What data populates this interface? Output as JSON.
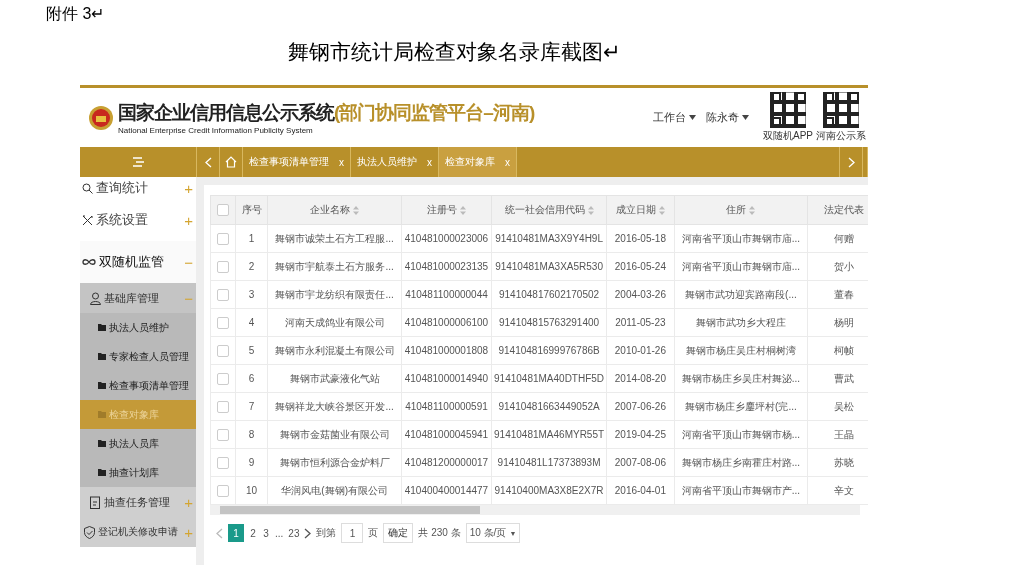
{
  "document": {
    "caption": "附件 3↵",
    "title": "舞钢市统计局检查对象名录库截图↵"
  },
  "header": {
    "logo_title": "国家企业信用信息公示系统",
    "logo_subtitle": "(部门协同监管平台–河南)",
    "logo_english": "National Enterprise Credit Information Publicity System",
    "menus": [
      "工作台",
      "陈永奇"
    ],
    "qr_codes": [
      {
        "label": "双随机APP"
      },
      {
        "label": "河南公示系"
      }
    ]
  },
  "tabs": [
    {
      "label": "检查事项清单管理",
      "selected": false,
      "close": "x"
    },
    {
      "label": "执法人员维护",
      "selected": false,
      "close": "x"
    },
    {
      "label": "检查对象库",
      "selected": true,
      "close": "x"
    }
  ],
  "sidebar": [
    {
      "label": "查询统计",
      "expanded": false,
      "toggle": "+"
    },
    {
      "label": "系统设置",
      "expanded": false,
      "toggle": "+"
    },
    {
      "label": "双随机监管",
      "expanded": true,
      "toggle": "−",
      "children": [
        {
          "label": "基础库管理",
          "expanded": true,
          "toggle": "−",
          "children": [
            {
              "label": "执法人员维护",
              "selected": false
            },
            {
              "label": "专家检查人员管理",
              "selected": false
            },
            {
              "label": "检查事项清单管理",
              "selected": false
            },
            {
              "label": "检查对象库",
              "selected": true
            },
            {
              "label": "执法人员库",
              "selected": false
            },
            {
              "label": "抽查计划库",
              "selected": false
            }
          ]
        },
        {
          "label": "抽查任务管理",
          "expanded": false,
          "toggle": "+"
        },
        {
          "label": "登记机关修改申请",
          "expanded": false,
          "toggle": "+"
        }
      ]
    }
  ],
  "table": {
    "select_all_checked": false,
    "columns": [
      {
        "label": "序号",
        "sortable": false
      },
      {
        "label": "企业名称",
        "sortable": true
      },
      {
        "label": "注册号",
        "sortable": true
      },
      {
        "label": "统一社会信用代码",
        "sortable": true
      },
      {
        "label": "成立日期",
        "sortable": true
      },
      {
        "label": "住所",
        "sortable": true
      },
      {
        "label": "法定代表",
        "sortable": false
      }
    ],
    "rows": [
      {
        "checked": false,
        "cells": [
          "1",
          "舞钢市诚荣土石方工程服...",
          "410481000023006",
          "91410481MA3X9Y4H9L",
          "2016-05-18",
          "河南省平顶山市舞钢市庙...",
          "何赠"
        ]
      },
      {
        "checked": false,
        "cells": [
          "2",
          "舞钢市宇航泰土石方服务...",
          "410481000023135",
          "91410481MA3XA5R530",
          "2016-05-24",
          "河南省平顶山市舞钢市庙...",
          "贺小"
        ]
      },
      {
        "checked": false,
        "cells": [
          "3",
          "舞钢市宇龙纺织有限责任...",
          "410481100000044",
          "914104817602170502",
          "2004-03-26",
          "舞钢市武功迎宾路南段(...",
          "董春"
        ]
      },
      {
        "checked": false,
        "cells": [
          "4",
          "河南天成鸽业有限公司",
          "410481000006100",
          "914104815763291400",
          "2011-05-23",
          "舞钢市武功乡大程庄",
          "杨明"
        ]
      },
      {
        "checked": false,
        "cells": [
          "5",
          "舞钢市永利混凝土有限公司",
          "410481000001808",
          "91410481699976786B",
          "2010-01-26",
          "舞钢市杨庄吴庄村桐树湾",
          "柯帧"
        ]
      },
      {
        "checked": false,
        "cells": [
          "6",
          "舞钢市武豪液化气站",
          "410481000014940",
          "91410481MA40DTHF5D",
          "2014-08-20",
          "舞钢市杨庄乡吴庄村舞泌...",
          "曹武"
        ]
      },
      {
        "checked": false,
        "cells": [
          "7",
          "舞钢祥龙大峡谷景区开发...",
          "410481100000591",
          "91410481663449052A",
          "2007-06-26",
          "舞钢市杨庄乡鏖坪村(完...",
          "吴松"
        ]
      },
      {
        "checked": false,
        "cells": [
          "8",
          "舞钢市金菇菌业有限公司",
          "410481000045941",
          "91410481MA46MYR55T",
          "2019-04-25",
          "河南省平顶山市舞钢市杨...",
          "王晶"
        ]
      },
      {
        "checked": false,
        "cells": [
          "9",
          "舞钢市恒利源合金炉料厂",
          "410481200000017",
          "91410481L17373893M",
          "2007-08-06",
          "舞钢市杨庄乡南霍庄村路...",
          "苏晓"
        ]
      },
      {
        "checked": false,
        "cells": [
          "10",
          "华润风电(舞钢)有限公司",
          "410400400014477",
          "91410400MA3X8E2X7R",
          "2016-04-01",
          "河南省平顶山市舞钢市产...",
          "辛文"
        ]
      }
    ]
  },
  "pagination": {
    "pages": [
      {
        "label": "1",
        "selected": true
      },
      {
        "label": "2",
        "selected": false
      },
      {
        "label": "3",
        "selected": false
      },
      {
        "label": "...",
        "selected": false
      },
      {
        "label": "23",
        "selected": false
      }
    ],
    "goto_label": "到第",
    "goto_value": "1",
    "page_unit": "页",
    "confirm": "确定",
    "total": "共 230 条",
    "page_size": "10 条/页",
    "dropdown": "▼"
  }
}
